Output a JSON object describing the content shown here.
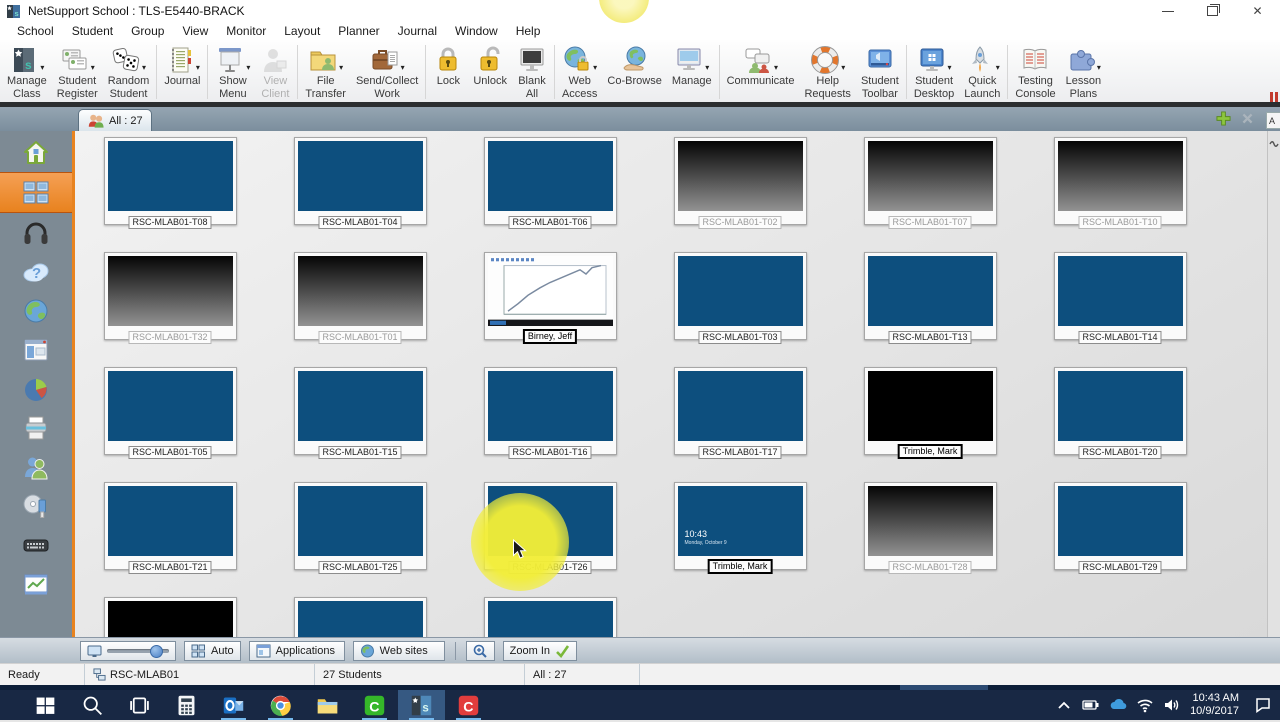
{
  "window": {
    "title": "NetSupport School : TLS-E5440-BRACK",
    "controls": [
      "minimize",
      "restore",
      "close"
    ]
  },
  "menubar": {
    "items": [
      "School",
      "Student",
      "Group",
      "View",
      "Monitor",
      "Layout",
      "Planner",
      "Journal",
      "Window",
      "Help"
    ]
  },
  "toolbar": {
    "buttons": [
      {
        "line1": "Manage",
        "line2": "Class",
        "icon": "manage-class-icon",
        "dropdown": true
      },
      {
        "line1": "Student",
        "line2": "Register",
        "icon": "student-register-icon",
        "dropdown": true
      },
      {
        "line1": "Random",
        "line2": "Student",
        "icon": "random-student-icon",
        "dropdown": true
      },
      {
        "line1": "Journal",
        "line2": "",
        "icon": "journal-icon",
        "dropdown": true
      },
      {
        "line1": "Show",
        "line2": "Menu",
        "icon": "show-menu-icon",
        "dropdown": true
      },
      {
        "line1": "View",
        "line2": "Client",
        "icon": "view-client-icon",
        "dropdown": false,
        "disabled": true
      },
      {
        "line1": "File",
        "line2": "Transfer",
        "icon": "file-transfer-icon",
        "dropdown": true
      },
      {
        "line1": "Send/Collect",
        "line2": "Work",
        "icon": "send-collect-icon",
        "dropdown": true
      },
      {
        "line1": "Lock",
        "line2": "",
        "icon": "lock-icon",
        "dropdown": false
      },
      {
        "line1": "Unlock",
        "line2": "",
        "icon": "unlock-icon",
        "dropdown": false
      },
      {
        "line1": "Blank",
        "line2": "All",
        "icon": "blank-all-icon",
        "dropdown": false
      },
      {
        "line1": "Web",
        "line2": "Access",
        "icon": "web-access-icon",
        "dropdown": true
      },
      {
        "line1": "Co-Browse",
        "line2": "",
        "icon": "co-browse-icon",
        "dropdown": false
      },
      {
        "line1": "Manage",
        "line2": "",
        "icon": "manage-monitor-icon",
        "dropdown": true
      },
      {
        "line1": "Communicate",
        "line2": "",
        "icon": "communicate-icon",
        "dropdown": true
      },
      {
        "line1": "Help",
        "line2": "Requests",
        "icon": "help-requests-icon",
        "dropdown": true
      },
      {
        "line1": "Student",
        "line2": "Toolbar",
        "icon": "student-toolbar-icon",
        "dropdown": false
      },
      {
        "line1": "Student",
        "line2": "Desktop",
        "icon": "student-desktop-icon",
        "dropdown": true
      },
      {
        "line1": "Quick",
        "line2": "Launch",
        "icon": "quick-launch-icon",
        "dropdown": true
      },
      {
        "line1": "Testing",
        "line2": "Console",
        "icon": "testing-console-icon",
        "dropdown": false
      },
      {
        "line1": "Lesson",
        "line2": "Plans",
        "icon": "lesson-plans-icon",
        "dropdown": true
      }
    ]
  },
  "tabbar": {
    "tab_label": "All : 27",
    "tab_icon": "people-icon",
    "actions": [
      "add-tab-icon",
      "close-tab-icon",
      "rename-icon"
    ],
    "rename_letter": "A"
  },
  "sidebar": {
    "items": [
      {
        "icon": "home-icon",
        "selected": false
      },
      {
        "icon": "thumbnails-icon",
        "selected": true
      },
      {
        "icon": "headphones-icon",
        "selected": false
      },
      {
        "icon": "question-cloud-icon",
        "selected": false
      },
      {
        "icon": "globe-icon",
        "selected": false
      },
      {
        "icon": "application-window-icon",
        "selected": false
      },
      {
        "icon": "pie-chart-icon",
        "selected": false
      },
      {
        "icon": "printer-icon",
        "selected": false
      },
      {
        "icon": "users-icon",
        "selected": false
      },
      {
        "icon": "device-cd-icon",
        "selected": false
      },
      {
        "icon": "keyboard-icon",
        "selected": false
      },
      {
        "icon": "whiteboard-icon",
        "selected": false
      }
    ]
  },
  "students": [
    {
      "name": "RSC-MLAB01-T08",
      "screen": "blue",
      "label_style": "normal"
    },
    {
      "name": "RSC-MLAB01-T04",
      "screen": "blue",
      "label_style": "normal"
    },
    {
      "name": "RSC-MLAB01-T06",
      "screen": "blue",
      "label_style": "normal"
    },
    {
      "name": "RSC-MLAB01-T02",
      "screen": "dark-gradient",
      "label_style": "dimmed"
    },
    {
      "name": "RSC-MLAB01-T07",
      "screen": "dark-gradient",
      "label_style": "dimmed"
    },
    {
      "name": "RSC-MLAB01-T10",
      "screen": "dark-gradient",
      "label_style": "dimmed"
    },
    {
      "name": "RSC-MLAB01-T32",
      "screen": "dark-gradient",
      "label_style": "dimmed"
    },
    {
      "name": "RSC-MLAB01-T01",
      "screen": "dark-gradient",
      "label_style": "dimmed"
    },
    {
      "name": "Birney, Jeff",
      "screen": "white-chart",
      "label_style": "highlighted"
    },
    {
      "name": "RSC-MLAB01-T03",
      "screen": "blue",
      "label_style": "normal"
    },
    {
      "name": "RSC-MLAB01-T13",
      "screen": "blue",
      "label_style": "normal"
    },
    {
      "name": "RSC-MLAB01-T14",
      "screen": "blue",
      "label_style": "normal"
    },
    {
      "name": "RSC-MLAB01-T05",
      "screen": "blue",
      "label_style": "normal"
    },
    {
      "name": "RSC-MLAB01-T15",
      "screen": "blue",
      "label_style": "normal"
    },
    {
      "name": "RSC-MLAB01-T16",
      "screen": "blue",
      "label_style": "normal"
    },
    {
      "name": "RSC-MLAB01-T17",
      "screen": "blue",
      "label_style": "normal"
    },
    {
      "name": "Trimble, Mark",
      "screen": "black",
      "label_style": "highlighted"
    },
    {
      "name": "RSC-MLAB01-T20",
      "screen": "blue",
      "label_style": "normal"
    },
    {
      "name": "RSC-MLAB01-T21",
      "screen": "blue",
      "label_style": "normal"
    },
    {
      "name": "RSC-MLAB01-T25",
      "screen": "blue",
      "label_style": "normal"
    },
    {
      "name": "RSC-MLAB01-T26",
      "screen": "blue",
      "label_style": "normal"
    },
    {
      "name": "Trimble, Mark",
      "screen": "lock-screen",
      "label_style": "highlighted"
    },
    {
      "name": "RSC-MLAB01-T28",
      "screen": "dark-gradient",
      "label_style": "dimmed"
    },
    {
      "name": "RSC-MLAB01-T29",
      "screen": "blue",
      "label_style": "normal"
    },
    {
      "name": "",
      "screen": "black",
      "label_style": "hidden"
    },
    {
      "name": "",
      "screen": "blue",
      "label_style": "hidden"
    },
    {
      "name": "",
      "screen": "blue",
      "label_style": "hidden"
    }
  ],
  "lock_screen": {
    "time": "10:43",
    "date": "Monday, October 9"
  },
  "bottom_toolbar": {
    "slider_icon": "monitor-size-icon",
    "auto_label": "Auto",
    "applications_label": "Applications",
    "web_sites_label": "Web sites",
    "zoom_in_label": "Zoom In",
    "zoom_icons": [
      "magnifier-plus-icon",
      "green-check-icon"
    ]
  },
  "statusbar": {
    "state": "Ready",
    "connection": "RSC-MLAB01",
    "students_count": "27 Students",
    "group": "All : 27"
  },
  "taskbar": {
    "icons": [
      "windows-start-icon",
      "search-icon",
      "task-view-icon",
      "calculator-icon",
      "outlook-icon",
      "chrome-icon",
      "file-explorer-icon",
      "camtasia-green-icon",
      "netsupport-icon",
      "camtasia-red-icon"
    ],
    "active_icon": "netsupport-icon",
    "tray": {
      "icons": [
        "chevron-up-icon",
        "battery-icon",
        "onedrive-cloud-icon",
        "wifi-icon",
        "volume-icon",
        "action-center-icon"
      ],
      "time": "10:43 AM",
      "date": "10/9/2017"
    }
  },
  "colors": {
    "screen_blue": "#0d4f7e",
    "sidebar_gray": "#7d8a94",
    "accent_orange": "#e8831f",
    "taskbar_navy": "#182844",
    "halo_yellow": "#f2ee37"
  }
}
